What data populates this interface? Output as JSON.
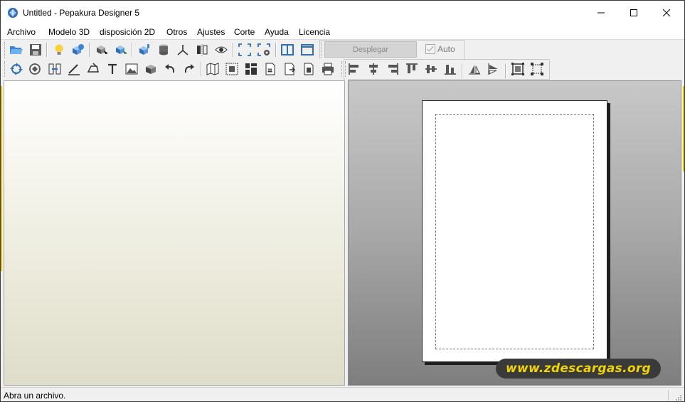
{
  "window": {
    "title": "Untitled - Pepakura Designer 5",
    "icon": "pepakura-app-icon"
  },
  "menu": [
    "Archivo",
    "Modelo 3D",
    "disposición 2D",
    "Otros",
    "Ajustes",
    "Corte",
    "Ayuda",
    "Licencia"
  ],
  "toolbar": {
    "desplegar_label": "Desplegar",
    "auto_label": "Auto",
    "auto_checked": true,
    "row1_icons": [
      "open-folder-icon",
      "save-icon",
      "light-bulb-icon",
      "model-cubes-icon",
      "select-3d-icon",
      "select-3d-alt-icon",
      "paint-cube-icon",
      "cylinder-icon",
      "axis-icon",
      "flip-icon",
      "eye-icon",
      "fit-view-icon",
      "fit-settings-icon",
      "single-view-icon",
      "split-view-icon"
    ],
    "row2_icons": [
      "rotate-icon",
      "rotate-part-icon",
      "join-icon",
      "edge-line-icon",
      "flap-icon",
      "text-icon",
      "image-icon",
      "box-icon",
      "undo-icon",
      "redo-icon",
      "unfold-map-icon",
      "arrange-icon",
      "layout-grid-icon",
      "page-number-icon",
      "page-export-icon",
      "page-settings-icon",
      "print-icon"
    ],
    "row3_icons": [
      "align-left-icon",
      "align-center-h-icon",
      "align-right-icon",
      "align-top-icon",
      "align-center-v-icon",
      "align-bottom-icon",
      "flip-horizontal-icon",
      "flip-vertical-icon",
      "fit-selection-icon",
      "select-all-icon"
    ]
  },
  "status": {
    "text": "Abra un archivo."
  },
  "watermark": {
    "text": "www.zdescargas.org",
    "color": "#f2d400"
  },
  "colors": {
    "accent_yellow": "#e8c400",
    "icon_blue": "#2e6fb8"
  }
}
